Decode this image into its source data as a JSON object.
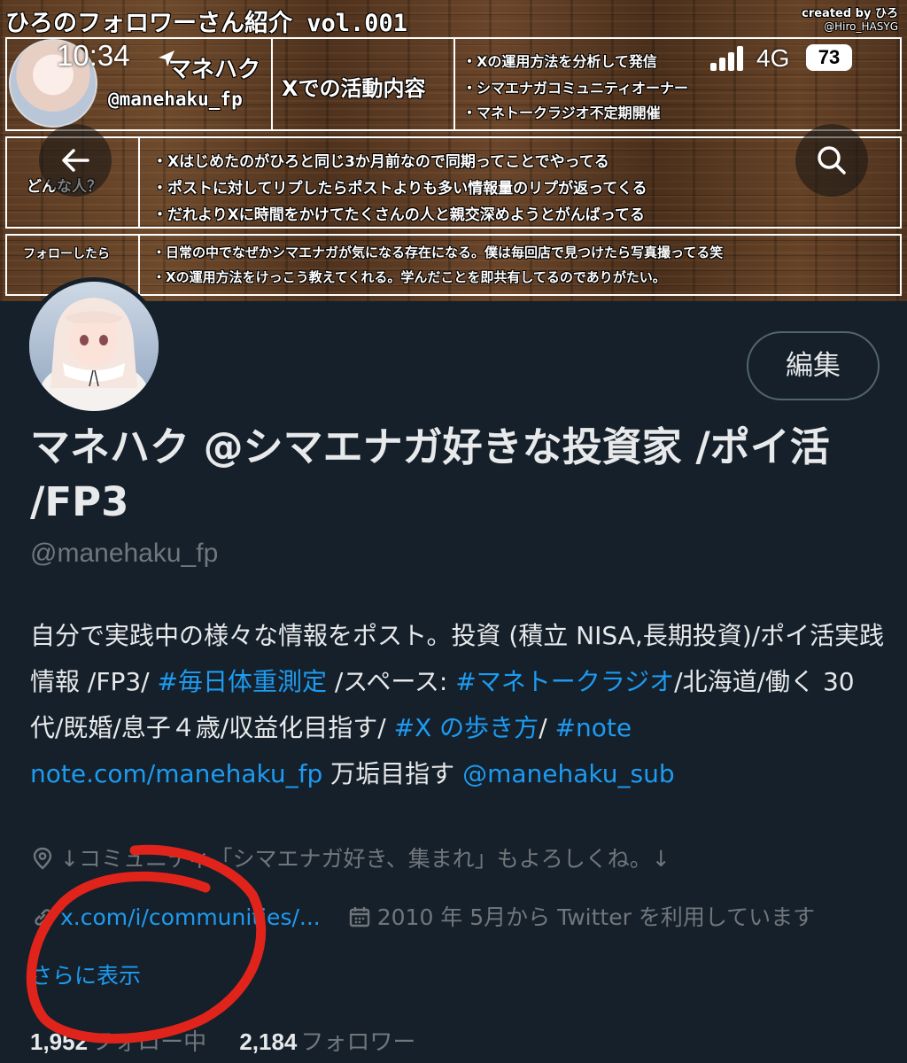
{
  "banner": {
    "title": "ひろのフォロワーさん紹介 vol.001",
    "credit": "created by ひろ",
    "credit_handle": "@Hiro_HASYG",
    "name_part": "マネハク",
    "handle": "@manehaku_fp",
    "activity_label": "Xでの活動内容",
    "activities": [
      "・Xの運用方法を分析して発信",
      "・シマエナガコミュニティオーナー",
      "・マネトークラジオ不定期開催"
    ],
    "who_label": "どんな人？",
    "who_items": [
      "・Xはじめたのがひろと同じ3か月前なので同期ってことでやってる",
      "・ポストに対してリプしたらポストよりも多い情報量のリプが返ってくる",
      "・だれよりXに時間をかけてたくさんの人と親交深めようとがんばってる"
    ],
    "follow_label": "フォローしたら",
    "follow_items": [
      "・日常の中でなぜかシマエナガが気になる存在になる。僕は毎回店で見つけたら写真撮ってる笑",
      "・Xの運用方法をけっこう教えてくれる。学んだことを即共有してるのでありがたい。"
    ]
  },
  "status_bar": {
    "time": "10:34",
    "network": "4G",
    "battery": "73",
    "signal_bars": 4
  },
  "nav": {
    "back_icon": "back-arrow-icon",
    "search_icon": "search-icon"
  },
  "profile": {
    "edit_label": "編集",
    "display_name": "マネハク @シマエナガ好きな投資家 /ポイ活 /FP3",
    "username": "@manehaku_fp",
    "bio": {
      "part1": "自分で実践中の様々な情報をポスト。投資 (積立 NISA,長期投資)/ポイ活実践情報 /FP3/ ",
      "tag1": "#毎日体重測定",
      "part2": " /スペース: ",
      "tag2": "#マネトークラジオ",
      "part3": "/北海道/働く 30 代/既婚/息子４歳/収益化目指す/ ",
      "tag3": "#X の歩き方",
      "part4": "/ ",
      "tag4": "#note",
      "part5": " ",
      "link": "note.com/manehaku_fp",
      "part6": " 万垢目指す ",
      "mention": "@manehaku_sub"
    },
    "location": "↓コミュニティ「シマエナガ好き、集まれ」もよろしくね。↓",
    "link": "x.com/i/communities/...",
    "joined": "2010 年 5月から Twitter を利用しています",
    "show_more": "さらに表示",
    "following_count": "1,952",
    "following_label": "フォロー中",
    "followers_count": "2,184",
    "followers_label": "フォロワー"
  },
  "colors": {
    "background": "#15202b",
    "accent": "#1d9bf0",
    "muted": "#71767b",
    "annotation": "#e0241b"
  }
}
